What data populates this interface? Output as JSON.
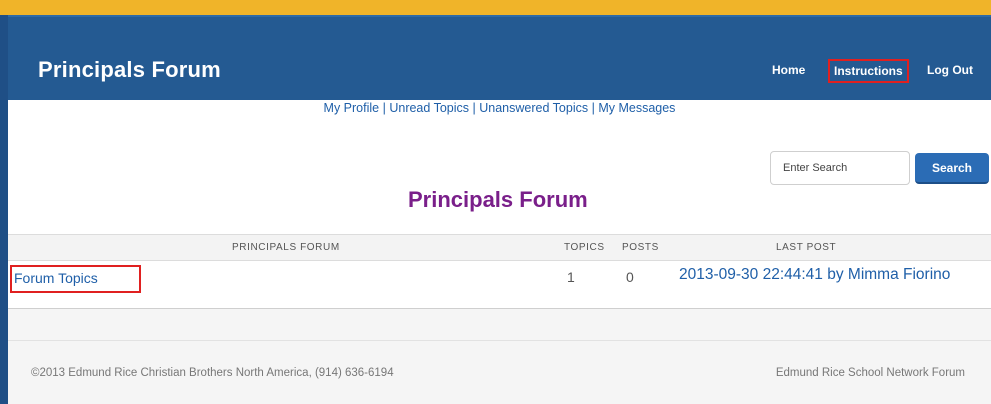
{
  "header": {
    "site_title": "Principals Forum",
    "nav": {
      "home": "Home",
      "instructions": "Instructions",
      "logout": "Log Out"
    }
  },
  "subnav": {
    "items": [
      "My Profile",
      "Unread Topics",
      "Unanswered Topics",
      "My Messages"
    ],
    "separator": "|"
  },
  "search": {
    "placeholder": "Enter Search",
    "button_label": "Search"
  },
  "page_title": "Principals Forum",
  "table": {
    "headers": {
      "forum": "PRINCIPALS FORUM",
      "topics": "TOPICS",
      "posts": "POSTS",
      "last_post": "LAST POST"
    },
    "rows": [
      {
        "forum": "Forum Topics",
        "topics": "1",
        "posts": "0",
        "last_post": "2013-09-30 22:44:41 by Mimma Fiorino"
      }
    ]
  },
  "footer": {
    "left": "©2013 Edmund Rice Christian Brothers North America, (914) 636-6194",
    "right": "Edmund Rice School Network Forum"
  },
  "colors": {
    "header_bg": "#245a92",
    "topbar": "#f0b429",
    "heading": "#7a1f8a",
    "link": "#1f5fa8",
    "highlight": "#e02020"
  }
}
